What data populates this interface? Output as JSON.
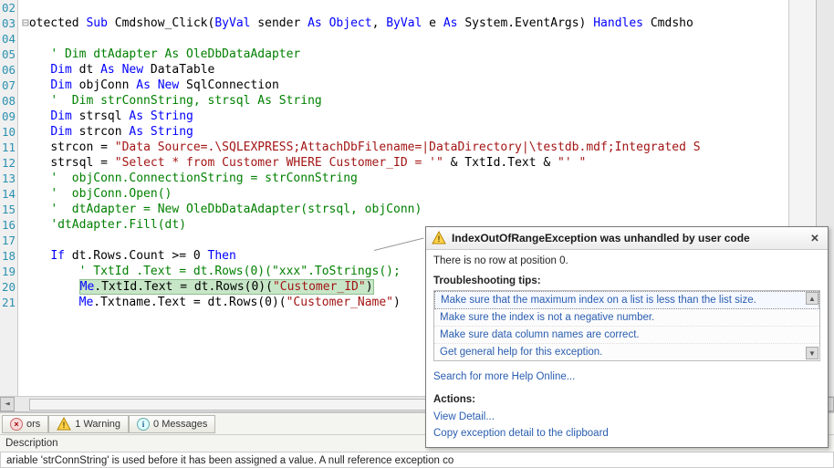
{
  "editor": {
    "line_numbers": [
      "02",
      "03",
      "04",
      "05",
      "06",
      "07",
      "08",
      "09",
      "10",
      "11",
      "12",
      "13",
      "14",
      "15",
      "16",
      "17",
      "18",
      "19",
      "20",
      "21"
    ],
    "tokens": {
      "l02_a": "otected ",
      "l02_kw1": "Sub",
      "l02_b": " Cmdshow_Click(",
      "l02_kw2": "ByVal",
      "l02_c": " sender ",
      "l02_kw3": "As",
      "l02_d": " ",
      "l02_kw4": "Object",
      "l02_e": ", ",
      "l02_kw5": "ByVal",
      "l02_f": " e ",
      "l02_kw6": "As",
      "l02_g": " System.EventArgs) ",
      "l02_kw7": "Handles",
      "l02_h": " Cmdsho",
      "l04_cmt": "' Dim dtAdapter As OleDbDataAdapter",
      "l05_kw1": "Dim",
      "l05_a": " dt ",
      "l05_kw2": "As",
      "l05_b": " ",
      "l05_kw3": "New",
      "l05_c": " DataTable",
      "l06_kw1": "Dim",
      "l06_a": " objConn ",
      "l06_kw2": "As",
      "l06_b": " ",
      "l06_kw3": "New",
      "l06_c": " SqlConnection",
      "l07_cmt": "'  Dim strConnString, strsql As String",
      "l08_kw1": "Dim",
      "l08_a": " strsql ",
      "l08_kw2": "As",
      "l08_b": " ",
      "l08_kw3": "String",
      "l09_kw1": "Dim",
      "l09_a": " strcon ",
      "l09_kw2": "As",
      "l09_b": " ",
      "l09_kw3": "String",
      "l10_a": "strcon = ",
      "l10_str": "\"Data Source=.\\SQLEXPRESS;AttachDbFilename=|DataDirectory|\\testdb.mdf;Integrated S",
      "l11_a": "strsql = ",
      "l11_str1": "\"Select * from Customer WHERE Customer_ID = '\"",
      "l11_b": " & TxtId.Text & ",
      "l11_str2": "\"' \"",
      "l12_cmt": "'  objConn.ConnectionString = strConnString",
      "l13_cmt": "'  objConn.Open()",
      "l14_cmt": "'  dtAdapter = New OleDbDataAdapter(strsql, objConn)",
      "l15_cmt": "'dtAdapter.Fill(dt)",
      "l17_kw1": "If",
      "l17_a": " dt.Rows.Count >= 0 ",
      "l17_kw2": "Then",
      "l18_cmt": "' TxtId .Text = dt.Rows(0)(\"xxx\".ToStrings();",
      "l19_a": "Me",
      "l19_b": ".TxtId.Text = dt.Rows(0)(",
      "l19_str": "\"Customer_ID\"",
      "l19_c": ")",
      "l20_a": "Me",
      "l20_b": ".Txtname.Text = dt.Rows(0)(",
      "l20_str": "\"Customer_Name\"",
      "l20_c": ")"
    }
  },
  "bottom": {
    "tab_errors": "ors",
    "tab_warnings_count": "1 Warning",
    "tab_messages_count": "0 Messages",
    "desc_label": "Description",
    "desc_text": "ariable 'strConnString' is used before it has been assigned a value. A null reference exception co"
  },
  "popup": {
    "title": "IndexOutOfRangeException was unhandled by user code",
    "message": "There is no row at position 0.",
    "tips_label": "Troubleshooting tips:",
    "tips": [
      "Make sure that the maximum index on a list is less than the list size.",
      "Make sure the index is not a negative number.",
      "Make sure data column names are correct.",
      "Get general help for this exception."
    ],
    "search_link": "Search for more Help Online...",
    "actions_label": "Actions:",
    "action_view": "View Detail...",
    "action_copy": "Copy exception detail to the clipboard"
  }
}
